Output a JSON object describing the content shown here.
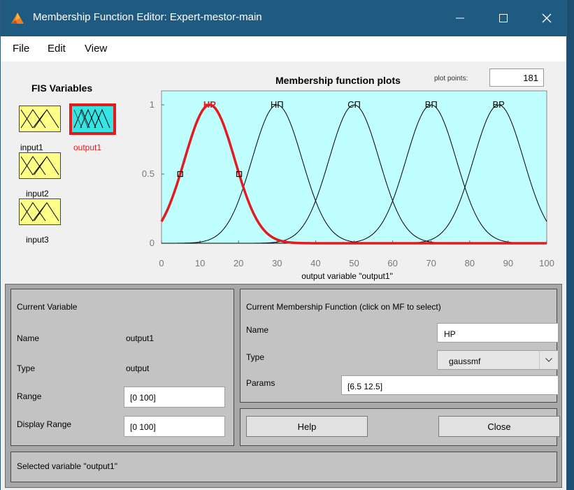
{
  "window": {
    "title": "Membership Function Editor: Expert-mestor-main"
  },
  "menu": [
    "File",
    "Edit",
    "View"
  ],
  "fis": {
    "title": "FIS Variables",
    "variables": [
      {
        "label": "input1",
        "selected": false
      },
      {
        "label": "output1",
        "selected": true
      },
      {
        "label": "input2",
        "selected": false
      },
      {
        "label": "input3",
        "selected": false
      }
    ]
  },
  "plot": {
    "title": "Membership function plots",
    "plot_points_label": "plot points:",
    "plot_points_value": "181",
    "xlabel": "output variable \"output1\"",
    "selected_color": "#e41a1c",
    "background_color": "#bfffff"
  },
  "chart_data": {
    "type": "line",
    "xlim": [
      0,
      100
    ],
    "ylim": [
      0,
      1
    ],
    "xticks": [
      "0",
      "10",
      "20",
      "30",
      "40",
      "50",
      "60",
      "70",
      "80",
      "90",
      "100"
    ],
    "yticks": [
      "0",
      "0.5",
      "1"
    ],
    "mf_type": "gaussmf",
    "series": [
      {
        "name": "HP",
        "sigma": 6.5,
        "center": 12.5,
        "selected": true
      },
      {
        "name": "НП",
        "sigma": 6.5,
        "center": 30,
        "selected": false
      },
      {
        "name": "СП",
        "sigma": 6.5,
        "center": 50,
        "selected": false
      },
      {
        "name": "ВП",
        "sigma": 6.5,
        "center": 70,
        "selected": false
      },
      {
        "name": "ВР",
        "sigma": 6.5,
        "center": 87.5,
        "selected": false
      }
    ]
  },
  "current_variable": {
    "title": "Current Variable",
    "name_label": "Name",
    "name_value": "output1",
    "type_label": "Type",
    "type_value": "output",
    "range_label": "Range",
    "range_value": "[0 100]",
    "display_range_label": "Display Range",
    "display_range_value": "[0 100]"
  },
  "current_mf": {
    "title": "Current Membership Function (click on MF to select)",
    "name_label": "Name",
    "name_value": "HP",
    "type_label": "Type",
    "type_value": "gaussmf",
    "params_label": "Params",
    "params_value": "[6.5 12.5]"
  },
  "buttons": {
    "help": "Help",
    "close": "Close"
  },
  "status": "Selected variable \"output1\""
}
